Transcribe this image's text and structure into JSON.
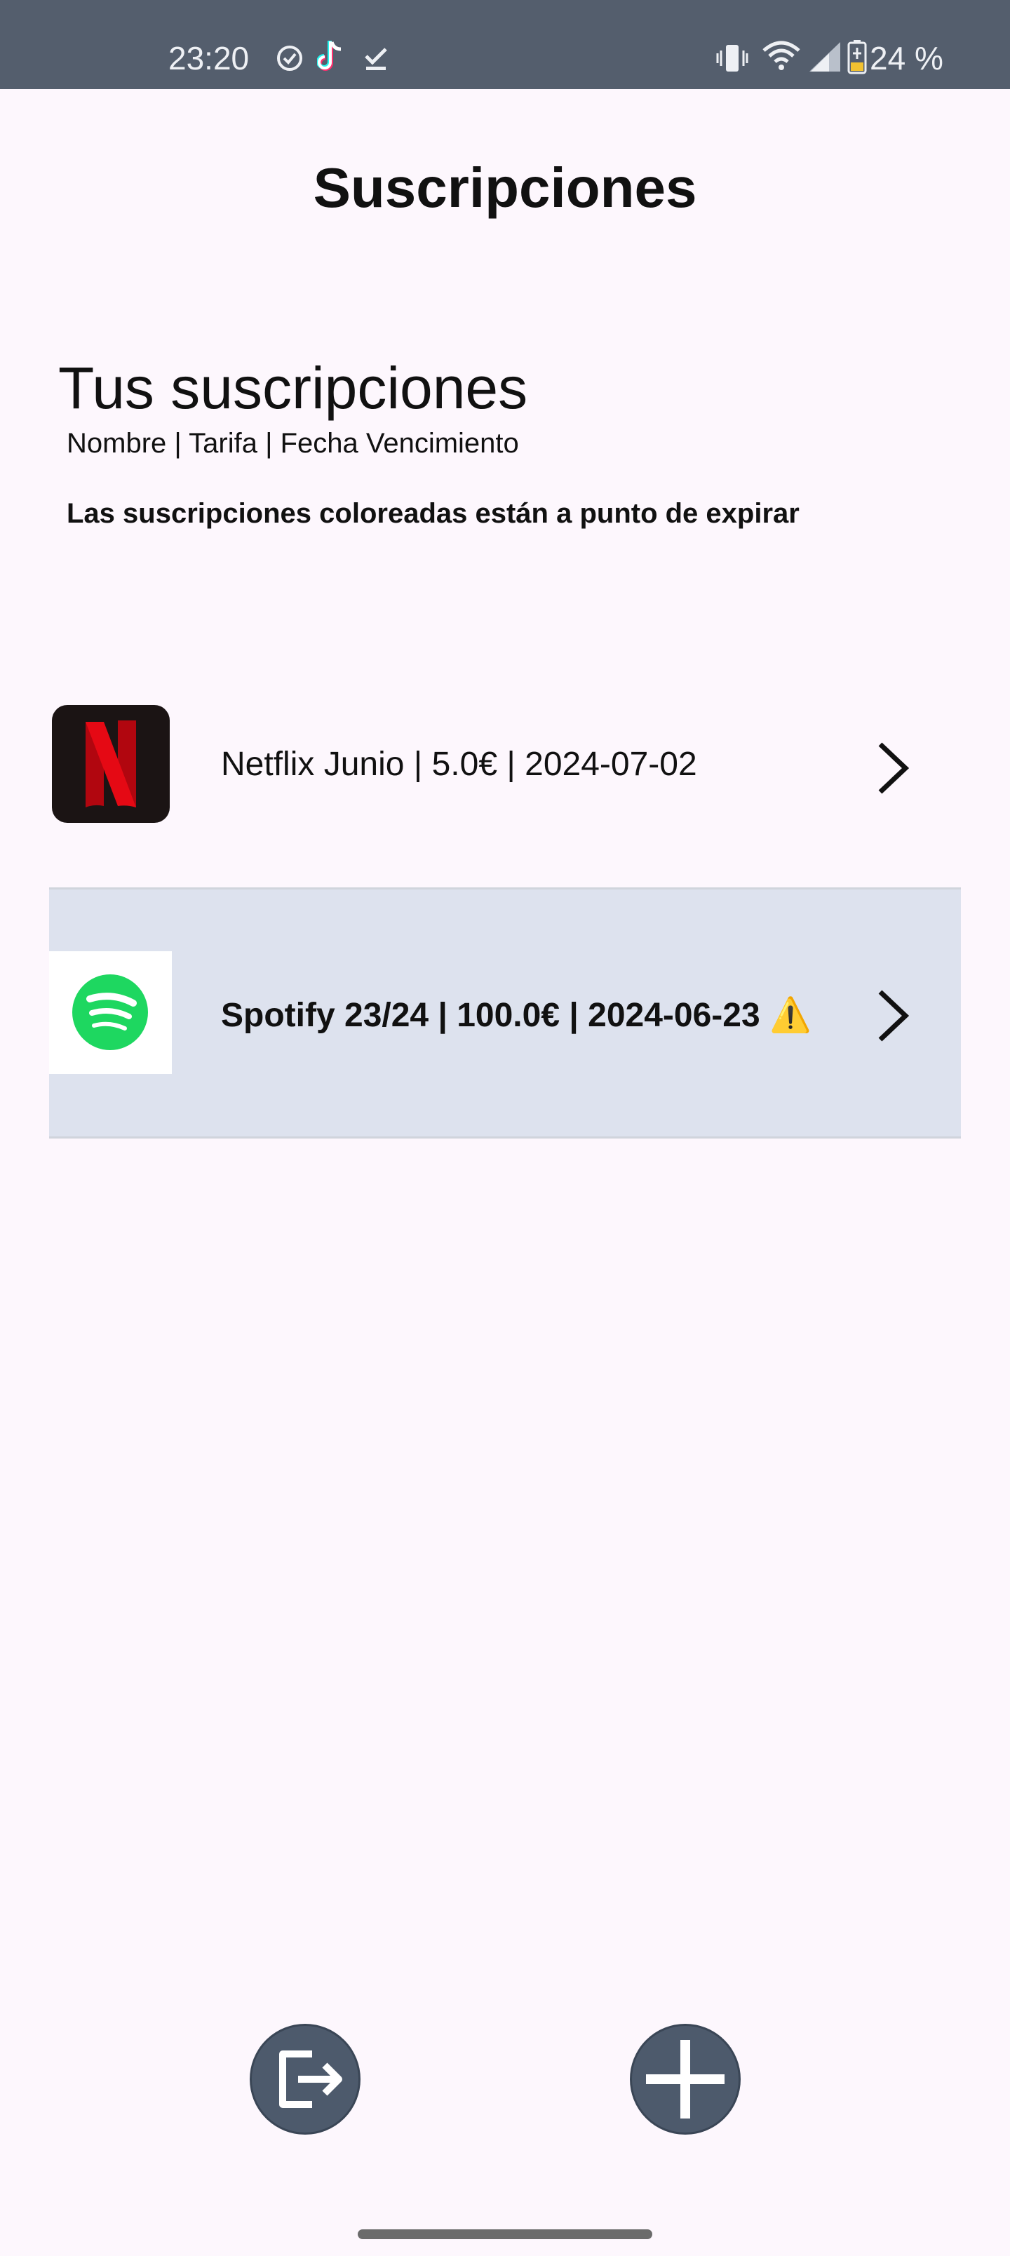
{
  "status_bar": {
    "time": "23:20",
    "battery": "24 %",
    "icons": [
      "task-check-icon",
      "tiktok-icon",
      "download-done-icon",
      "vibrate-icon",
      "wifi-icon",
      "signal-icon",
      "battery-icon"
    ],
    "background": "#545e6d"
  },
  "app_bar": {
    "title": "Suscripciones"
  },
  "section": {
    "title": "Tus suscripciones",
    "columns": "Nombre | Tarifa | Fecha Vencimiento",
    "note": "Las suscripciones coloreadas están a punto de expirar"
  },
  "subscriptions": [
    {
      "label": "Netflix Junio | 5.0€ | 2024-07-02",
      "logo": "netflix-logo",
      "highlighted": false
    },
    {
      "label": "Spotify 23/24 | 100.0€ | 2024-06-23",
      "warning": "⚠️",
      "logo": "spotify-logo",
      "highlighted": true,
      "highlight_color": "#dde2ee"
    }
  ],
  "actions": {
    "logout_icon": "logout-icon",
    "add_icon": "plus-icon",
    "fab_color": "#4d5a6c"
  }
}
